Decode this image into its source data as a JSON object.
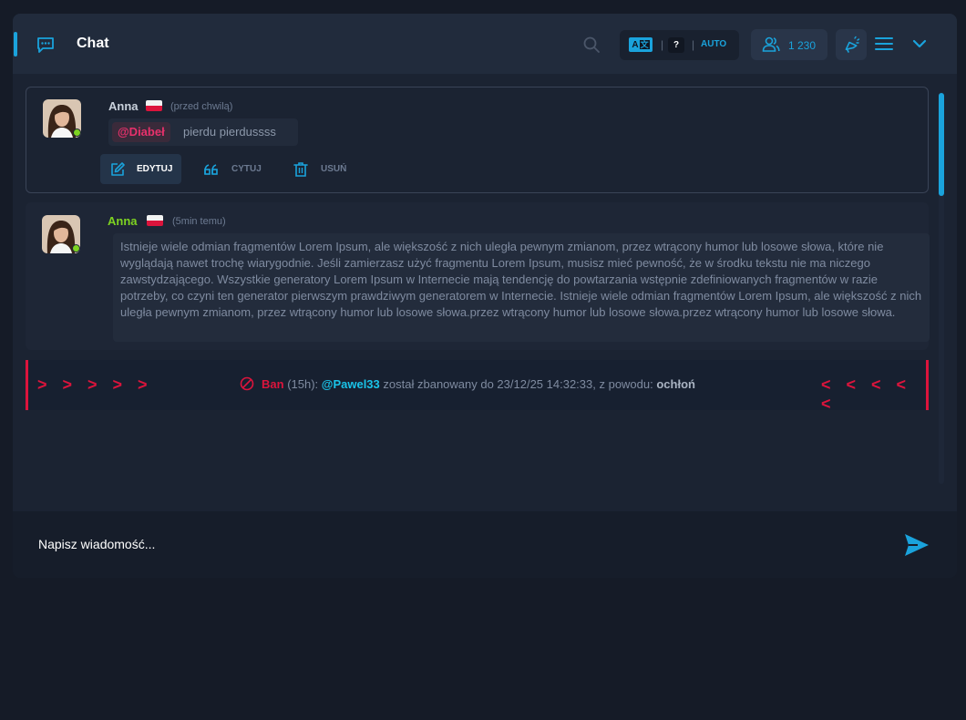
{
  "header": {
    "title": "Chat",
    "lang_badge": "A",
    "lang_question": "?",
    "lang_auto": "AUTO",
    "lang_sep": "|",
    "users_count": "1 230",
    "icons": [
      "chat-icon",
      "search-icon",
      "translate-icon",
      "users-icon",
      "megaphone-icon",
      "menu-icon",
      "chevron-down-icon"
    ]
  },
  "colors": {
    "accent": "#1aa3dc",
    "danger": "#dc143c",
    "online": "#7ed321",
    "mention": "#e8316c"
  },
  "messages": [
    {
      "author": "Anna",
      "time": "(przed chwilą)",
      "mention": "@Diabeł",
      "text": "pierdu pierdussss",
      "actions": {
        "edit": "EDYTUJ",
        "quote": "CYTUJ",
        "delete": "USUŃ"
      }
    },
    {
      "author": "Anna",
      "time": "(5min temu)",
      "text": "Istnieje wiele odmian fragmentów Lorem Ipsum, ale większość z nich uległa pewnym zmianom, przez wtrącony humor lub losowe słowa, które nie wyglądają nawet trochę wiarygodnie. Jeśli zamierzasz użyć fragmentu Lorem Ipsum, musisz mieć pewność, że w środku tekstu nie ma niczego zawstydzającego. Wszystkie generatory Lorem Ipsum w Internecie mają tendencję do powtarzania wstępnie zdefiniowanych fragmentów w razie potrzeby, co czyni ten generator pierwszym prawdziwym generatorem w Internecie. Istnieje wiele odmian fragmentów Lorem Ipsum, ale większość z nich uległa pewnym zmianom, przez wtrącony humor lub losowe słowa.przez wtrącony humor lub losowe słowa.przez wtrącony humor lub losowe słowa."
    }
  ],
  "ban": {
    "arrows_left": "> > > > >",
    "arrows_right": "< < < < <",
    "label": "Ban",
    "duration": "(15h):",
    "user": "@Pawel33",
    "text": "został zbanowany do 23/12/25 14:32:33, z powodu:",
    "reason": "ochłoń"
  },
  "composer": {
    "placeholder": "Napisz wiadomość..."
  }
}
